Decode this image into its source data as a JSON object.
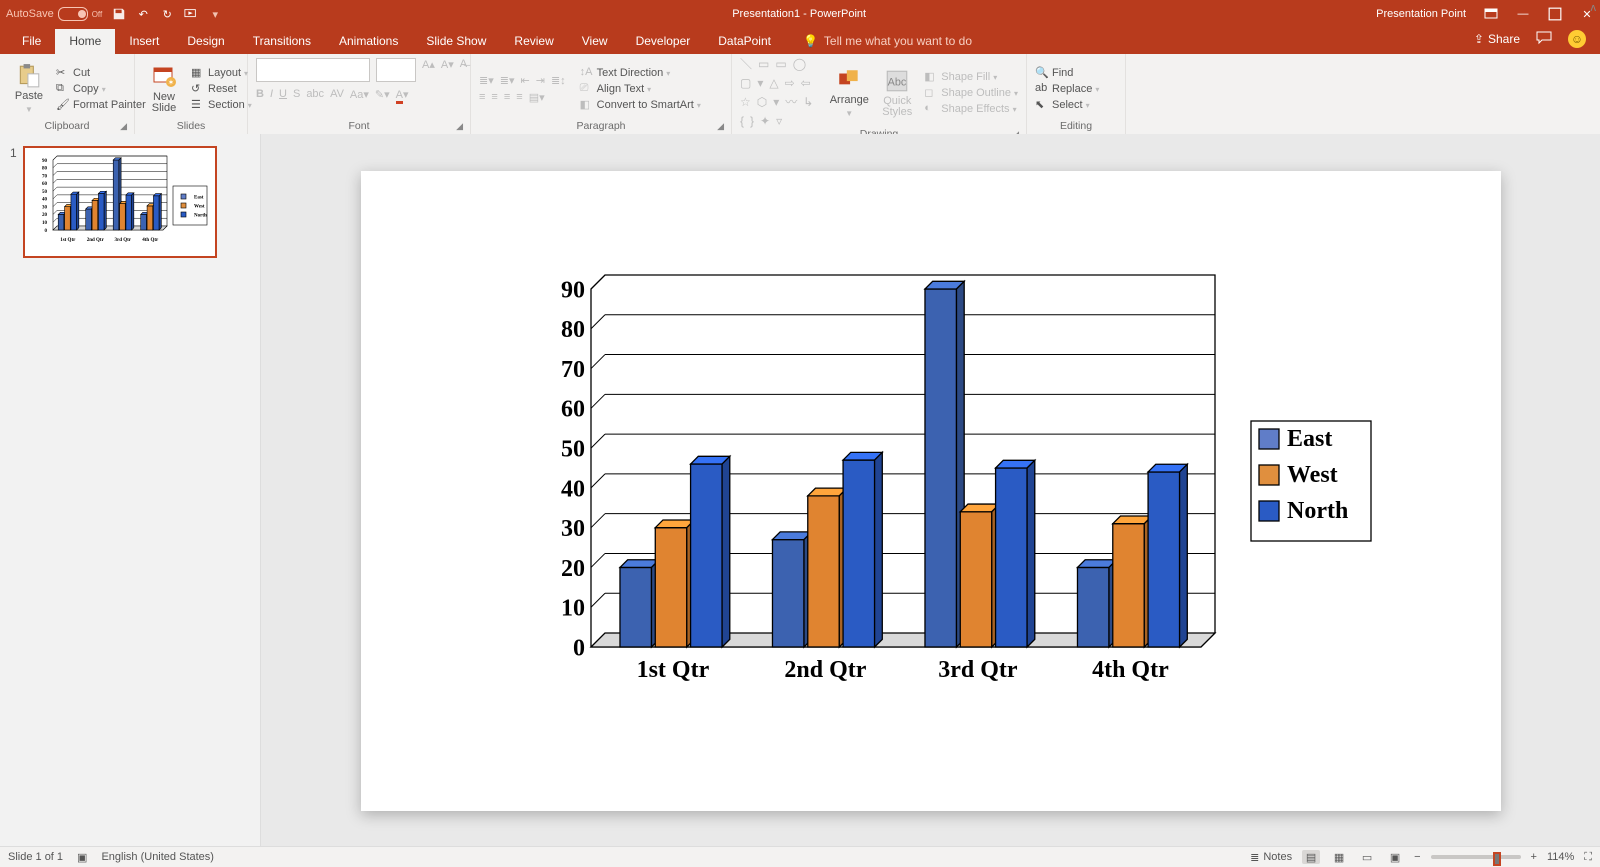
{
  "app": {
    "title": "Presentation1 - PowerPoint",
    "brand": "Presentation Point"
  },
  "quick_access": {
    "autosave_label": "AutoSave",
    "autosave_state": "Off"
  },
  "tabs": [
    "File",
    "Home",
    "Insert",
    "Design",
    "Transitions",
    "Animations",
    "Slide Show",
    "Review",
    "View",
    "Developer",
    "DataPoint"
  ],
  "active_tab": "Home",
  "tell_me": "Tell me what you want to do",
  "share_label": "Share",
  "ribbon": {
    "clipboard": {
      "label": "Clipboard",
      "paste": "Paste",
      "cut": "Cut",
      "copy": "Copy",
      "fmt": "Format Painter"
    },
    "slides": {
      "label": "Slides",
      "new_slide": "New\nSlide",
      "layout": "Layout",
      "reset": "Reset",
      "section": "Section"
    },
    "font": {
      "label": "Font",
      "font_name": "",
      "font_size": ""
    },
    "paragraph": {
      "label": "Paragraph",
      "text_direction": "Text Direction",
      "align_text": "Align Text",
      "smartart": "Convert to SmartArt"
    },
    "drawing": {
      "label": "Drawing",
      "arrange": "Arrange",
      "quick_styles": "Quick\nStyles",
      "shape_fill": "Shape Fill",
      "shape_outline": "Shape Outline",
      "shape_effects": "Shape Effects"
    },
    "editing": {
      "label": "Editing",
      "find": "Find",
      "replace": "Replace",
      "select": "Select"
    }
  },
  "thumb": {
    "number": "1"
  },
  "statusbar": {
    "slide_info": "Slide 1 of 1",
    "language": "English (United States)",
    "notes": "Notes",
    "zoom": "114%"
  },
  "chart_data": {
    "type": "bar",
    "categories": [
      "1st Qtr",
      "2nd Qtr",
      "3rd Qtr",
      "4th Qtr"
    ],
    "series": [
      {
        "name": "East",
        "color": "#3c62b0",
        "values": [
          20,
          27,
          90,
          20
        ]
      },
      {
        "name": "West",
        "color": "#e08430",
        "values": [
          30,
          38,
          34,
          31
        ]
      },
      {
        "name": "North",
        "color": "#2a5bc4",
        "values": [
          46,
          47,
          45,
          44
        ]
      }
    ],
    "legend_colors": [
      "#607dc8",
      "#e08f3e",
      "#2a5bc4"
    ],
    "y_ticks": [
      0,
      10,
      20,
      30,
      40,
      50,
      60,
      70,
      80,
      90
    ],
    "ylim": [
      0,
      90
    ]
  }
}
